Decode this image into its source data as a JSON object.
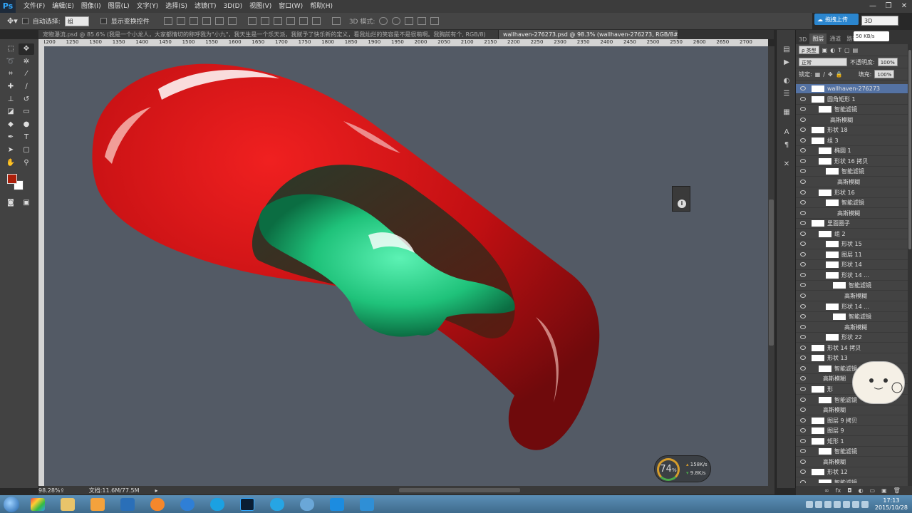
{
  "app": {
    "logo": "Ps",
    "menu": [
      "文件(F)",
      "编辑(E)",
      "图像(I)",
      "图层(L)",
      "文字(Y)",
      "选择(S)",
      "滤镜(T)",
      "3D(D)",
      "视图(V)",
      "窗口(W)",
      "帮助(H)"
    ],
    "window_controls": [
      "—",
      "❐",
      "✕"
    ]
  },
  "upload_button": "拖拽上传",
  "workspace_mode": "3D",
  "options_bar": {
    "auto_select_label": "自动选择:",
    "auto_select_value": "组",
    "show_transform_label": "显示变换控件",
    "mode_3d_label": "3D 模式:"
  },
  "tabs": [
    {
      "title": "宠物瀑流.psd @ 85.6% (我是一个小龙人，大家都情切的称呼我为\"小九\"，我天生是一个乐天派，我赋予了快乐新的定义，看我灿烂的笑容是不是很萌啊。我胸前有个, RGB/8)",
      "active": false
    },
    {
      "title": "wallhaven-276273.psd @ 98.3% (wallhaven-276273, RGB/8#) *",
      "active": true
    }
  ],
  "ruler_top": [
    "1200",
    "1250",
    "1300",
    "1350",
    "1400",
    "1450",
    "1500",
    "1550",
    "1600",
    "1650",
    "1700",
    "1750",
    "1800",
    "1850",
    "1900",
    "1950",
    "2000",
    "2050",
    "2100",
    "2150",
    "2200",
    "2250",
    "2300",
    "2350",
    "2400",
    "2450",
    "2500",
    "2550",
    "2600",
    "2650",
    "2700"
  ],
  "status": {
    "zoom": "98.28%",
    "doc": "文档:11.6M/77.5M"
  },
  "net_widget": {
    "percent": "74",
    "percent_sign": "%",
    "up": "158K/s",
    "down": "9.8K/s"
  },
  "layers_panel": {
    "tabs": [
      "3D",
      "图层",
      "通道",
      "路径"
    ],
    "speed": "50 KB/s",
    "filter_kind": "ρ 类型",
    "blend_mode": "正常",
    "opacity_label": "不透明度:",
    "opacity_value": "100%",
    "lock_label": "锁定:",
    "fill_label": "填充:",
    "fill_value": "100%",
    "layers": [
      {
        "name": "wallhaven-276273",
        "indent": 0,
        "selected": true
      },
      {
        "name": "圆角矩形 1",
        "indent": 0
      },
      {
        "name": "智能滤镜",
        "indent": 1
      },
      {
        "name": "高斯模糊",
        "indent": 2
      },
      {
        "name": "形状 18",
        "indent": 0
      },
      {
        "name": "组 3",
        "indent": 0
      },
      {
        "name": "椭圆 1",
        "indent": 1
      },
      {
        "name": "形状 16 拷贝",
        "indent": 1
      },
      {
        "name": "智能滤镜",
        "indent": 2
      },
      {
        "name": "高斯模糊",
        "indent": 3
      },
      {
        "name": "形状 16",
        "indent": 1
      },
      {
        "name": "智能滤镜",
        "indent": 2
      },
      {
        "name": "高斯模糊",
        "indent": 3
      },
      {
        "name": "里面圈子",
        "indent": 0
      },
      {
        "name": "组 2",
        "indent": 1
      },
      {
        "name": "形状 15",
        "indent": 2
      },
      {
        "name": "图层 11",
        "indent": 2
      },
      {
        "name": "形状 14",
        "indent": 2
      },
      {
        "name": "形状 14 ...",
        "indent": 2
      },
      {
        "name": "智能滤镜",
        "indent": 3
      },
      {
        "name": "高斯模糊",
        "indent": 4
      },
      {
        "name": "形状 14 ...",
        "indent": 2
      },
      {
        "name": "智能滤镜",
        "indent": 3
      },
      {
        "name": "高斯模糊",
        "indent": 4
      },
      {
        "name": "形状 22",
        "indent": 2
      },
      {
        "name": "形状 14 拷贝",
        "indent": 0
      },
      {
        "name": "形状 13",
        "indent": 0
      },
      {
        "name": "智能滤镜",
        "indent": 1
      },
      {
        "name": "高斯模糊",
        "indent": 1
      },
      {
        "name": "形",
        "indent": 0
      },
      {
        "name": "智能滤镜",
        "indent": 1
      },
      {
        "name": "高斯模糊",
        "indent": 1
      },
      {
        "name": "图层 9 拷贝",
        "indent": 0
      },
      {
        "name": "图层 9",
        "indent": 0
      },
      {
        "name": "矩形 1",
        "indent": 0
      },
      {
        "name": "智能滤镜",
        "indent": 1
      },
      {
        "name": "高斯模糊",
        "indent": 1
      },
      {
        "name": "形状 12",
        "indent": 0
      },
      {
        "name": "智能滤镜",
        "indent": 1
      }
    ],
    "footer_icons": [
      "link-icon",
      "fx-icon",
      "mask-icon",
      "adjust-icon",
      "folder-icon",
      "new-layer-icon",
      "trash-icon"
    ]
  },
  "clock": {
    "time": "17:13",
    "date": "2015/10/28"
  },
  "colors": {
    "foreground": "#ac1f0a",
    "background": "#ffffff",
    "canvas": "#535a65",
    "accent": "#2b86cf"
  }
}
